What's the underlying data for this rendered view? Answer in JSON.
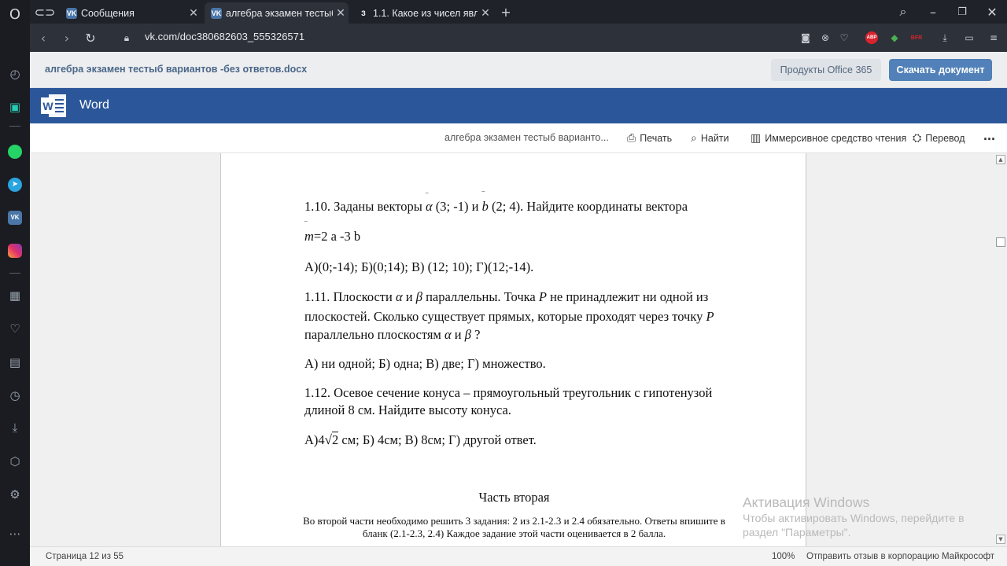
{
  "sidebar": {
    "icons": [
      "opera-logo-icon",
      "speed-dial-icon",
      "twitch-icon",
      "whatsapp-icon",
      "telegram-icon",
      "vk-icon",
      "instagram-icon",
      "workspaces-icon",
      "heart-icon",
      "news-icon",
      "history-icon",
      "downloads-icon",
      "extensions-icon",
      "settings-icon",
      "more-icon"
    ]
  },
  "tabs": [
    {
      "label": "Сообщения",
      "favicon": "VK"
    },
    {
      "label": "алгебра экзамен тестыб вари",
      "favicon": "VK"
    },
    {
      "label": "1.1. Какое из чисел являе",
      "favicon": "З"
    }
  ],
  "address": {
    "url": "vk.com/doc380682603_555326571"
  },
  "vk_header": {
    "doc_name": "алгебра экзамен тестыб вариантов -без ответов.docx",
    "office_btn": "Продукты Office 365",
    "download_btn": "Скачать документ"
  },
  "word_header": {
    "title": "Word"
  },
  "toolbar": {
    "doc_title": "алгебра экзамен тестыб варианто...",
    "print": "Печать",
    "find": "Найти",
    "immersive": "Иммерсивное средство чтения",
    "translate": "Перевод",
    "more": "..."
  },
  "document": {
    "q110_a": "1.10.  Заданы векторы ",
    "q110_b": "(3; -1) и ",
    "q110_c": "(2; 4). Найдите координаты вектора",
    "q110_formula": "=2 a -3 b",
    "q110_answers": "А)(0;-14);     Б)(0;14);   В) (12; 10);      Г)(12;-14).",
    "q111_line1_a": "1.11.  Плоскости ",
    "q111_line1_b": " и ",
    "q111_line1_c": " параллельны. Точка ",
    "q111_line1_d": " не принадлежит ни одной из",
    "q111_line2": "плоскостей. Сколько существует прямых, которые проходят через точку ",
    "q111_line3_a": "параллельно плоскостям ",
    "q111_line3_b": " и ",
    "q111_line3_c": " ?",
    "q111_answers": "А) ни одной;     Б) одна;       В) две;        Г) множество.",
    "q112_line1": "1.12.  Осевое сечение конуса – прямоугольный треугольник с гипотенузой",
    "q112_line2": "длиной 8 см. Найдите высоту конуса.",
    "q112_ans_a1": "А)4",
    "q112_ans_a2": "2",
    "q112_ans_rest": " см;       Б) 4см;        В) 8см;        Г) другой ответ.",
    "part_two_title": "Часть вторая",
    "part_two_line1": "Во второй части необходимо решить 3 задания: 2  из 2.1-2.3 и 2.4 обязательно. Ответы впишите в",
    "part_two_line2": "бланк (2.1-2.3, 2.4) Каждое задание этой части оценивается в 2 балла."
  },
  "status": {
    "page": "Страница 12 из 55",
    "zoom": "100%",
    "feedback": "Отправить отзыв в корпорацию Майкрософт"
  },
  "watermark": {
    "title": "Активация Windows",
    "line1": "Чтобы активировать Windows, перейдите в",
    "line2": "раздел \"Параметры\"."
  },
  "colors": {
    "word_blue": "#2b579a",
    "vk_button": "#5181b8"
  }
}
